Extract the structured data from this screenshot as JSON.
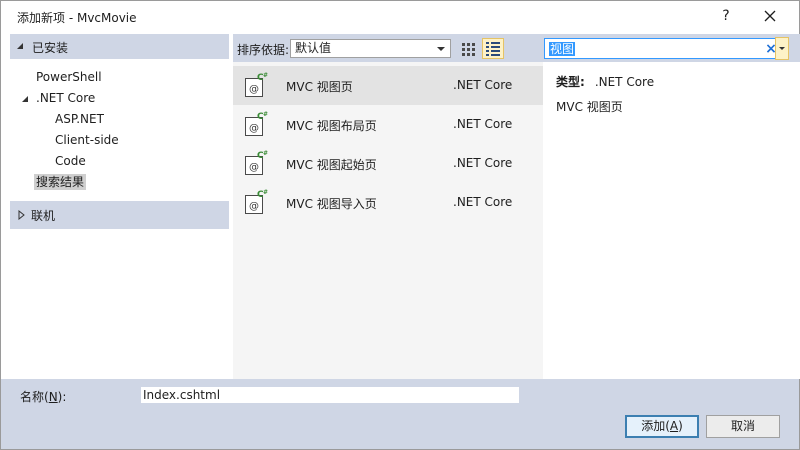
{
  "window": {
    "title": "添加新项 - MvcMovie",
    "help_glyph": "?"
  },
  "left": {
    "installed_label": "已安装",
    "tree": [
      {
        "label": "PowerShell"
      },
      {
        "label": ".NET Core"
      },
      {
        "label": "ASP.NET"
      },
      {
        "label": "Client-side"
      },
      {
        "label": "Code"
      },
      {
        "label": "搜索结果"
      }
    ],
    "online_label": "联机"
  },
  "toolbar": {
    "sort_label": "排序依据:",
    "sort_value": "默认值"
  },
  "search": {
    "value": "视图"
  },
  "templates": [
    {
      "name": "MVC 视图页",
      "type": ".NET Core"
    },
    {
      "name": "MVC 视图布局页",
      "type": ".NET Core"
    },
    {
      "name": "MVC 视图起始页",
      "type": ".NET Core"
    },
    {
      "name": "MVC 视图导入页",
      "type": ".NET Core"
    }
  ],
  "details": {
    "type_key": "类型:",
    "type_value": ".NET Core",
    "description": "MVC 视图页"
  },
  "bottom": {
    "name_label_pre": "名称(",
    "name_label_key": "N",
    "name_label_post": "):",
    "name_value": "Index.cshtml",
    "add_pre": "添加(",
    "add_key": "A",
    "add_post": ")",
    "cancel_label": "取消"
  },
  "colors": {
    "panel_blue": "#cfd6e5",
    "search_highlight": "#3399ff",
    "csharp_green": "#388a34"
  },
  "icons": {
    "template_icon": "csharp-razor-file-icon"
  }
}
